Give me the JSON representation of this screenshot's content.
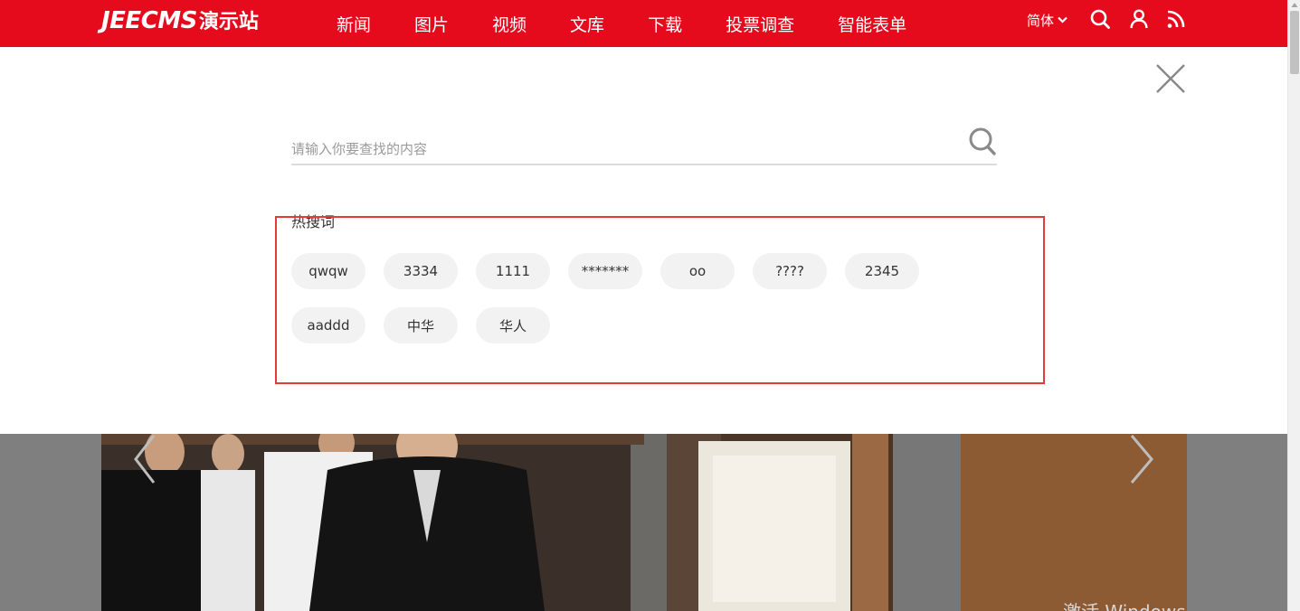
{
  "header": {
    "logo_en": "JEECMS",
    "logo_cn": "演示站",
    "nav": [
      {
        "label": "新闻"
      },
      {
        "label": "图片"
      },
      {
        "label": "视频"
      },
      {
        "label": "文库"
      },
      {
        "label": "下载"
      },
      {
        "label": "投票调查"
      },
      {
        "label": "智能表单"
      }
    ],
    "language": "简体",
    "icons": [
      "search-icon",
      "user-icon",
      "rss-icon"
    ]
  },
  "search": {
    "placeholder": "请输入你要查找的内容",
    "value": ""
  },
  "hot": {
    "title": "热搜词",
    "tags": [
      "qwqw",
      "3334",
      "1111",
      "*******",
      "oo",
      "????",
      "2345",
      "aaddd",
      "中华",
      "华人"
    ]
  },
  "watermark": "激活 Windows",
  "colors": {
    "brand_red": "#e60a1d",
    "highlight": "#e33a3a",
    "tag_bg": "#f2f2f2"
  }
}
